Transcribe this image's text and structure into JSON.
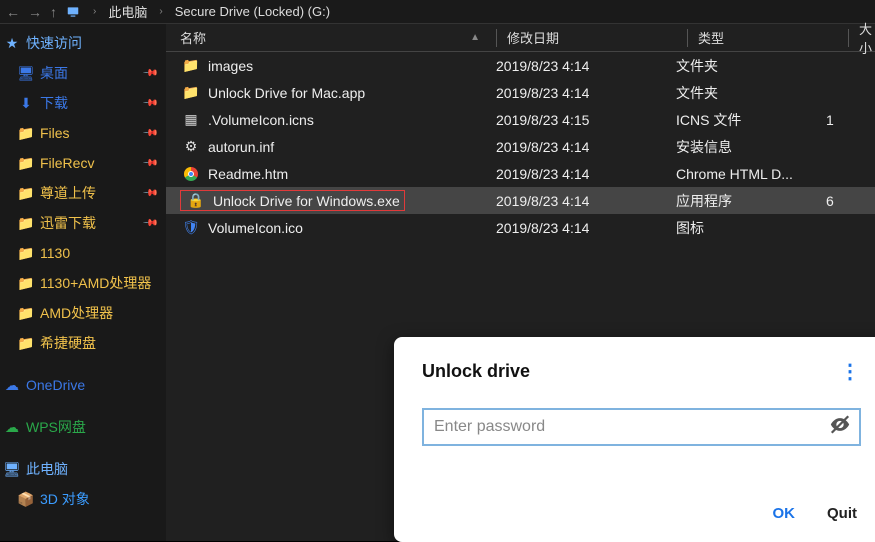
{
  "breadcrumb": {
    "segment1": "此电脑",
    "segment2": "Secure Drive (Locked) (G:)"
  },
  "columns": {
    "name": "名称",
    "date": "修改日期",
    "type": "类型",
    "size": "大小"
  },
  "sidebar": {
    "items": [
      {
        "label": "快速访问",
        "icon": "star",
        "class": "star section",
        "pinned": false
      },
      {
        "label": "桌面",
        "icon": "desk",
        "class": "desk indent",
        "pinned": true
      },
      {
        "label": "下载",
        "icon": "down",
        "class": "down indent",
        "pinned": true
      },
      {
        "label": "Files",
        "icon": "folder",
        "class": "folder indent",
        "pinned": true
      },
      {
        "label": "FileRecv",
        "icon": "folder",
        "class": "folder indent",
        "pinned": true
      },
      {
        "label": "尊道上传",
        "icon": "folder",
        "class": "folder indent",
        "pinned": true
      },
      {
        "label": "迅雷下载",
        "icon": "folder",
        "class": "folder indent",
        "pinned": true
      },
      {
        "label": "1130",
        "icon": "folder",
        "class": "folder indent",
        "pinned": false
      },
      {
        "label": "1130+AMD处理器",
        "icon": "folder",
        "class": "folder indent",
        "pinned": false
      },
      {
        "label": "AMD处理器",
        "icon": "folder",
        "class": "folder indent",
        "pinned": false
      },
      {
        "label": "希捷硬盘",
        "icon": "folder",
        "class": "folder indent",
        "pinned": false
      },
      {
        "label": "OneDrive",
        "icon": "cloud",
        "class": "cloud section",
        "pinned": false
      },
      {
        "label": "WPS网盘",
        "icon": "cloud",
        "class": "green section",
        "pinned": false
      },
      {
        "label": "此电脑",
        "icon": "pc",
        "class": "pc section",
        "pinned": false
      },
      {
        "label": "3D 对象",
        "icon": "cube",
        "class": "cube indent",
        "pinned": false
      }
    ]
  },
  "files": [
    {
      "name": "images",
      "date": "2019/8/23 4:14",
      "type": "文件夹",
      "size": "",
      "icon": "folder",
      "selected": false,
      "highlight": false
    },
    {
      "name": "Unlock Drive for Mac.app",
      "date": "2019/8/23 4:14",
      "type": "文件夹",
      "size": "",
      "icon": "folder",
      "selected": false,
      "highlight": false
    },
    {
      "name": ".VolumeIcon.icns",
      "date": "2019/8/23 4:15",
      "type": "ICNS 文件",
      "size": "1",
      "icon": "icns",
      "selected": false,
      "highlight": false
    },
    {
      "name": "autorun.inf",
      "date": "2019/8/23 4:14",
      "type": "安装信息",
      "size": "",
      "icon": "inf",
      "selected": false,
      "highlight": false
    },
    {
      "name": "Readme.htm",
      "date": "2019/8/23 4:14",
      "type": "Chrome HTML D...",
      "size": "",
      "icon": "chrome",
      "selected": false,
      "highlight": false
    },
    {
      "name": "Unlock Drive for Windows.exe",
      "date": "2019/8/23 4:14",
      "type": "应用程序",
      "size": "6",
      "icon": "lock",
      "selected": true,
      "highlight": true
    },
    {
      "name": "VolumeIcon.ico",
      "date": "2019/8/23 4:14",
      "type": "图标",
      "size": "",
      "icon": "shield",
      "selected": false,
      "highlight": false
    }
  ],
  "dialog": {
    "title": "Unlock drive",
    "placeholder": "Enter password",
    "ok": "OK",
    "quit": "Quit"
  }
}
